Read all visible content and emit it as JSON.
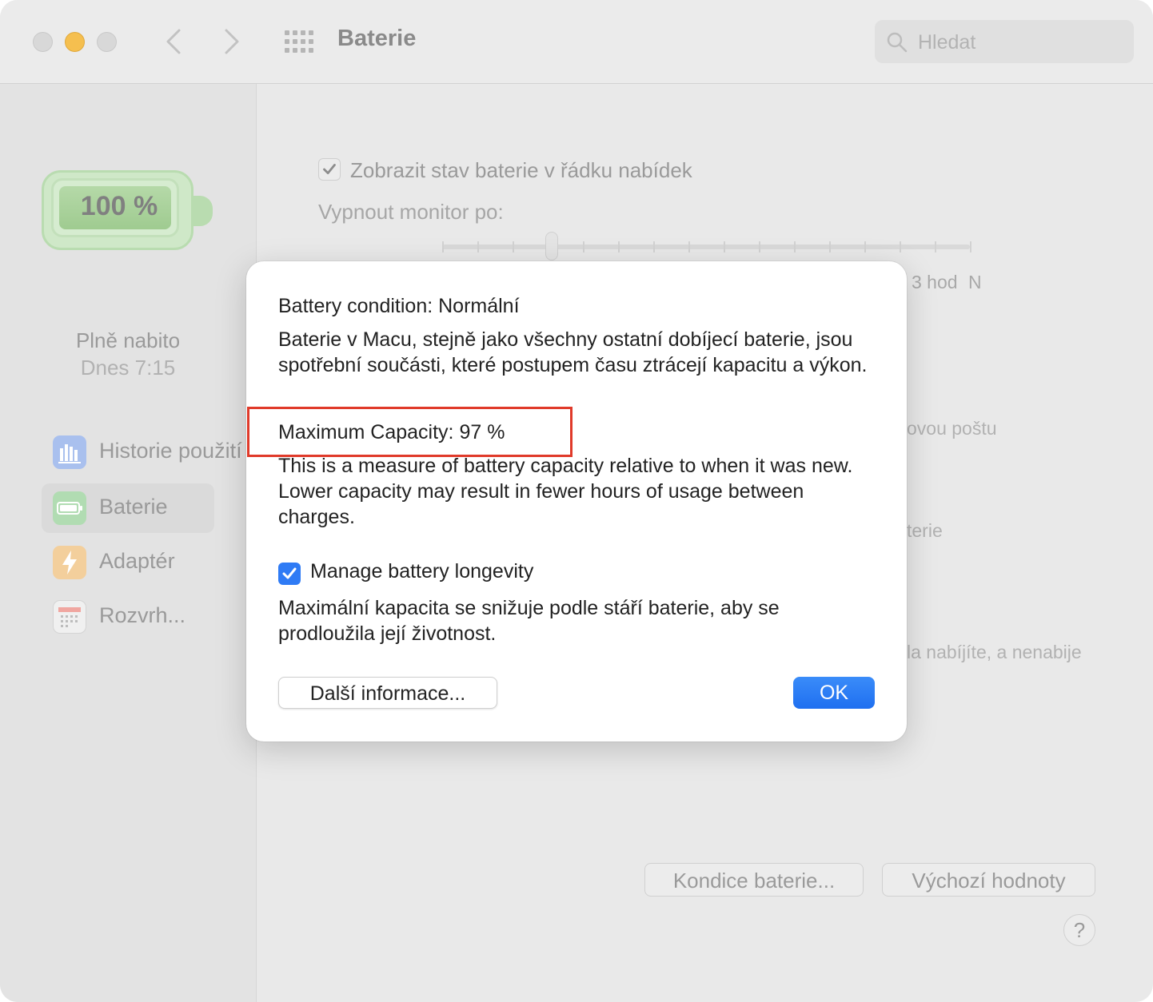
{
  "window": {
    "title": "Baterie"
  },
  "search": {
    "placeholder": "Hledat"
  },
  "sidebar": {
    "battery_percent": "100 %",
    "status": "Plně nabito",
    "time": "Dnes 7:15",
    "items": [
      {
        "label": "Historie použití",
        "icon": "usage-history-icon",
        "color": "#5e8ff0"
      },
      {
        "label": "Baterie",
        "icon": "battery-icon",
        "color": "#6ac56b",
        "selected": true
      },
      {
        "label": "Adaptér",
        "icon": "power-adapter-icon",
        "color": "#f3a63a"
      },
      {
        "label": "Rozvrh...",
        "icon": "calendar-icon",
        "color": "#e9e9e9"
      }
    ]
  },
  "main": {
    "show_status_label": "Zobrazit stav baterie v řádku nabídek",
    "show_status_checked": true,
    "turn_off_label": "Vypnout monitor po:",
    "slider_labels": {
      "three_hours": "3 hod",
      "never_fragment": "N"
    },
    "fragments": {
      "mail": "ovou poštu",
      "battery": "terie",
      "charge": "la nabíjíte, a nenabije"
    },
    "battery_health_button": "Kondice baterie...",
    "defaults_button": "Výchozí hodnoty",
    "help_button": "?"
  },
  "dialog": {
    "condition": "Battery condition: Normální",
    "condition_desc": "Baterie v Macu, stejně jako všechny ostatní dobíjecí baterie, jsou spotřební součásti, které postupem času ztrácejí kapacitu a výkon.",
    "max_capacity": "Maximum Capacity: 97 %",
    "max_capacity_desc": "This is a measure of battery capacity relative to when it was new. Lower capacity may result in fewer hours of usage between charges.",
    "manage_label": "Manage battery longevity",
    "manage_checked": true,
    "manage_desc": "Maximální kapacita se snižuje podle stáří baterie, aby se prodloužila její životnost.",
    "more_button": "Další informace...",
    "ok_button": "OK",
    "highlight_color": "#e03a2a",
    "accent_color": "#2f7bf5"
  }
}
